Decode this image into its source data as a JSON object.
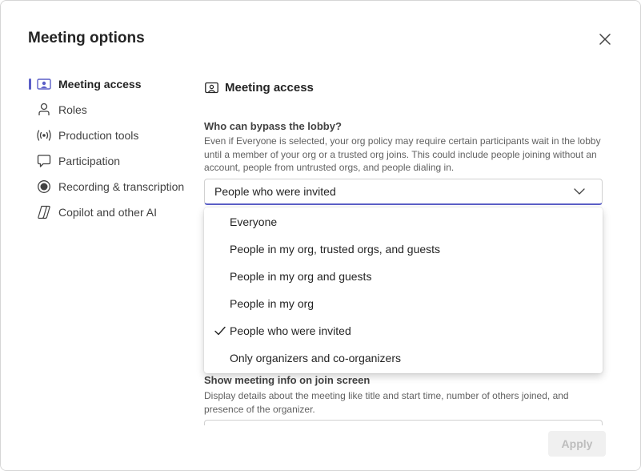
{
  "dialog": {
    "title": "Meeting options"
  },
  "sidebar": {
    "items": [
      {
        "label": "Meeting access",
        "icon": "meeting-access-icon",
        "active": true
      },
      {
        "label": "Roles",
        "icon": "person-icon"
      },
      {
        "label": "Production tools",
        "icon": "broadcast-icon"
      },
      {
        "label": "Participation",
        "icon": "chat-bubble-icon"
      },
      {
        "label": "Recording & transcription",
        "icon": "record-icon"
      },
      {
        "label": "Copilot and other AI",
        "icon": "copilot-icon"
      }
    ]
  },
  "main": {
    "section_title": "Meeting access",
    "lobby": {
      "label": "Who can bypass the lobby?",
      "description": "Even if Everyone is selected, your org policy may require certain participants wait in the lobby until a member of your org or a trusted org joins. This could include people joining without an account, people from untrusted orgs, and people dialing in.",
      "selected": "People who were invited",
      "options": [
        {
          "label": "Everyone"
        },
        {
          "label": "People in my org, trusted orgs, and guests"
        },
        {
          "label": "People in my org and guests"
        },
        {
          "label": "People in my org"
        },
        {
          "label": "People who were invited",
          "checked": true
        },
        {
          "label": "Only organizers and co-organizers"
        }
      ]
    },
    "join_screen": {
      "label": "Show meeting info on join screen",
      "description": "Display details about the meeting like title and start time, number of others joined, and presence of the organizer."
    }
  },
  "footer": {
    "apply_label": "Apply"
  },
  "colors": {
    "accent": "#5b5fc7",
    "text": "#242424",
    "muted": "#616161"
  }
}
